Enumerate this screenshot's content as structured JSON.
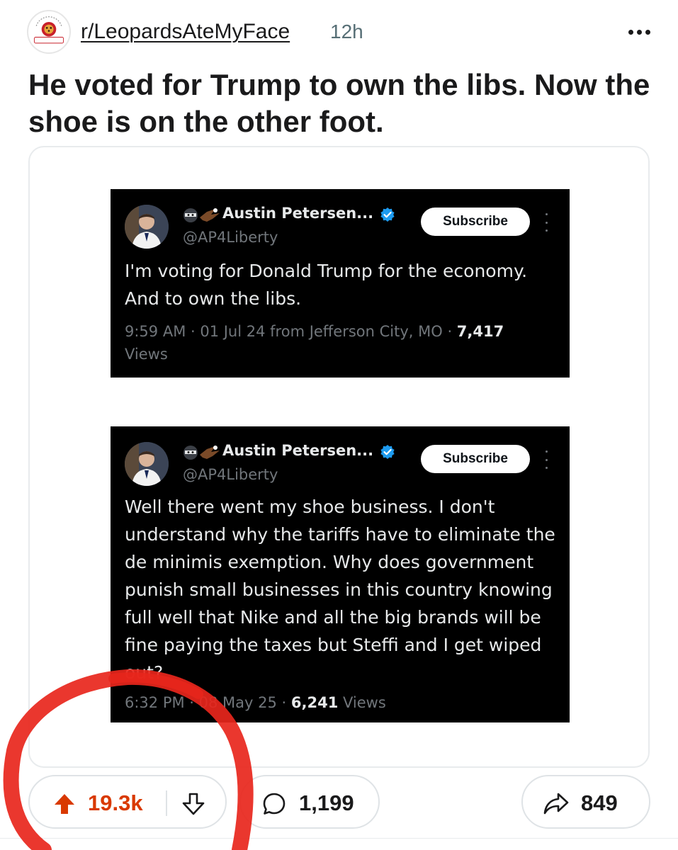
{
  "post": {
    "subreddit": "r/LeopardsAteMyFace",
    "age": "12h",
    "subreddit_avatar_text": "PROUD MEMBER",
    "title": "He voted for Trump to own the libs. Now the shoe is on the other foot."
  },
  "tweets": [
    {
      "display_name": "Austin Petersen...",
      "handle": "@AP4Liberty",
      "subscribe_label": "Subscribe",
      "body": "I'm voting for Donald Trump for the economy. And to own the libs.",
      "meta_prefix": "9:59 AM · 01 Jul 24 from Jefferson City, MO · ",
      "views_count": "7,417",
      "views_label": " Views"
    },
    {
      "display_name": "Austin Petersen...",
      "handle": "@AP4Liberty",
      "subscribe_label": "Subscribe",
      "body": "Well there went my shoe business. I don't understand why the tariffs have to eliminate the de minimis exemption. Why does government punish small businesses in this country knowing full well that Nike and all the big brands will be fine paying the taxes but Steffi and I get wiped out?",
      "meta_prefix": "6:32 PM · 08 May 25 · ",
      "views_count": "6,241",
      "views_label": " Views"
    }
  ],
  "actions": {
    "upvotes": "19.3k",
    "comments": "1,199",
    "shares": "849"
  },
  "colors": {
    "upvote_accent": "#d93900",
    "annotation_red": "#e8261c",
    "verified_blue": "#1d9bf0"
  },
  "icons": {
    "upvote": "upvote-arrow-icon",
    "downvote": "downvote-arrow-icon",
    "comment": "comment-bubble-icon",
    "share": "share-arrow-icon",
    "more": "more-options-icon",
    "verified": "verified-badge-icon"
  }
}
